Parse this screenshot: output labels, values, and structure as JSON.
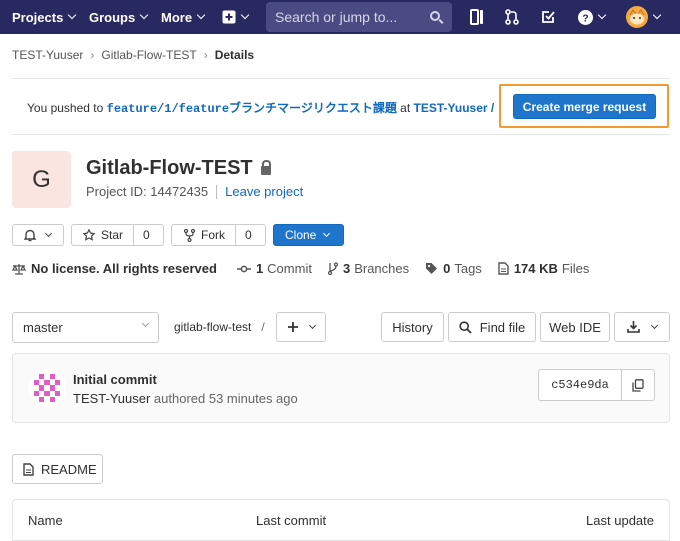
{
  "topbar": {
    "nav": [
      {
        "label": "Projects"
      },
      {
        "label": "Groups"
      },
      {
        "label": "More"
      }
    ],
    "search_placeholder": "Search or jump to...",
    "icons": [
      "plus-square-icon",
      "search-icon",
      "sidebar-icon",
      "merge-request-icon",
      "todo-icon",
      "help-icon",
      "user-avatar"
    ]
  },
  "breadcrumb": [
    "TEST-Yuuser",
    "Gitlab-Flow-TEST",
    "Details"
  ],
  "push_banner": {
    "prefix": "You pushed to ",
    "branch": "feature/1/featureブランチマージリクエスト課題",
    "at": " at ",
    "project": "TEST-Yuuser / Gi...",
    "button": "Create merge request"
  },
  "project": {
    "avatar_letter": "G",
    "name": "Gitlab-Flow-TEST",
    "id_label": "Project ID: 14472435",
    "leave": "Leave project"
  },
  "actions": {
    "star_label": "Star",
    "star_count": "0",
    "fork_label": "Fork",
    "fork_count": "0",
    "clone_label": "Clone"
  },
  "stats": {
    "license": "No license. All rights reserved",
    "commits_count": "1",
    "commits_label": "Commit",
    "branches_count": "3",
    "branches_label": "Branches",
    "tags_count": "0",
    "tags_label": "Tags",
    "files_size": "174 KB",
    "files_label": "Files"
  },
  "repo": {
    "branch": "master",
    "path": "gitlab-flow-test",
    "path_sep": "/",
    "history": "History",
    "find_file": "Find file",
    "web_ide": "Web IDE"
  },
  "commit": {
    "title": "Initial commit",
    "author": "TEST-Yuuser",
    "meta": " authored 53 minutes ago",
    "sha": "c534e9da"
  },
  "readme": "README",
  "table": {
    "name": "Name",
    "last_commit": "Last commit",
    "last_update": "Last update"
  },
  "colors": {
    "nav_bg": "#292961",
    "primary": "#1f75cb",
    "highlight": "#f09a30"
  }
}
